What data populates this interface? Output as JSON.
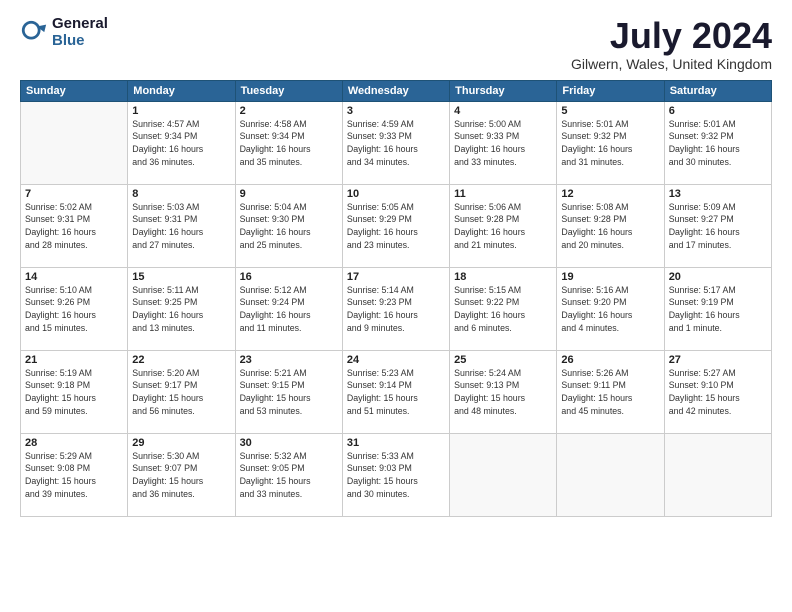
{
  "header": {
    "logo_general": "General",
    "logo_blue": "Blue",
    "month_title": "July 2024",
    "location": "Gilwern, Wales, United Kingdom"
  },
  "weekdays": [
    "Sunday",
    "Monday",
    "Tuesday",
    "Wednesday",
    "Thursday",
    "Friday",
    "Saturday"
  ],
  "days": [
    {
      "num": "",
      "info": ""
    },
    {
      "num": "1",
      "info": "Sunrise: 4:57 AM\nSunset: 9:34 PM\nDaylight: 16 hours\nand 36 minutes."
    },
    {
      "num": "2",
      "info": "Sunrise: 4:58 AM\nSunset: 9:34 PM\nDaylight: 16 hours\nand 35 minutes."
    },
    {
      "num": "3",
      "info": "Sunrise: 4:59 AM\nSunset: 9:33 PM\nDaylight: 16 hours\nand 34 minutes."
    },
    {
      "num": "4",
      "info": "Sunrise: 5:00 AM\nSunset: 9:33 PM\nDaylight: 16 hours\nand 33 minutes."
    },
    {
      "num": "5",
      "info": "Sunrise: 5:01 AM\nSunset: 9:32 PM\nDaylight: 16 hours\nand 31 minutes."
    },
    {
      "num": "6",
      "info": "Sunrise: 5:01 AM\nSunset: 9:32 PM\nDaylight: 16 hours\nand 30 minutes."
    },
    {
      "num": "7",
      "info": "Sunrise: 5:02 AM\nSunset: 9:31 PM\nDaylight: 16 hours\nand 28 minutes."
    },
    {
      "num": "8",
      "info": "Sunrise: 5:03 AM\nSunset: 9:31 PM\nDaylight: 16 hours\nand 27 minutes."
    },
    {
      "num": "9",
      "info": "Sunrise: 5:04 AM\nSunset: 9:30 PM\nDaylight: 16 hours\nand 25 minutes."
    },
    {
      "num": "10",
      "info": "Sunrise: 5:05 AM\nSunset: 9:29 PM\nDaylight: 16 hours\nand 23 minutes."
    },
    {
      "num": "11",
      "info": "Sunrise: 5:06 AM\nSunset: 9:28 PM\nDaylight: 16 hours\nand 21 minutes."
    },
    {
      "num": "12",
      "info": "Sunrise: 5:08 AM\nSunset: 9:28 PM\nDaylight: 16 hours\nand 20 minutes."
    },
    {
      "num": "13",
      "info": "Sunrise: 5:09 AM\nSunset: 9:27 PM\nDaylight: 16 hours\nand 17 minutes."
    },
    {
      "num": "14",
      "info": "Sunrise: 5:10 AM\nSunset: 9:26 PM\nDaylight: 16 hours\nand 15 minutes."
    },
    {
      "num": "15",
      "info": "Sunrise: 5:11 AM\nSunset: 9:25 PM\nDaylight: 16 hours\nand 13 minutes."
    },
    {
      "num": "16",
      "info": "Sunrise: 5:12 AM\nSunset: 9:24 PM\nDaylight: 16 hours\nand 11 minutes."
    },
    {
      "num": "17",
      "info": "Sunrise: 5:14 AM\nSunset: 9:23 PM\nDaylight: 16 hours\nand 9 minutes."
    },
    {
      "num": "18",
      "info": "Sunrise: 5:15 AM\nSunset: 9:22 PM\nDaylight: 16 hours\nand 6 minutes."
    },
    {
      "num": "19",
      "info": "Sunrise: 5:16 AM\nSunset: 9:20 PM\nDaylight: 16 hours\nand 4 minutes."
    },
    {
      "num": "20",
      "info": "Sunrise: 5:17 AM\nSunset: 9:19 PM\nDaylight: 16 hours\nand 1 minute."
    },
    {
      "num": "21",
      "info": "Sunrise: 5:19 AM\nSunset: 9:18 PM\nDaylight: 15 hours\nand 59 minutes."
    },
    {
      "num": "22",
      "info": "Sunrise: 5:20 AM\nSunset: 9:17 PM\nDaylight: 15 hours\nand 56 minutes."
    },
    {
      "num": "23",
      "info": "Sunrise: 5:21 AM\nSunset: 9:15 PM\nDaylight: 15 hours\nand 53 minutes."
    },
    {
      "num": "24",
      "info": "Sunrise: 5:23 AM\nSunset: 9:14 PM\nDaylight: 15 hours\nand 51 minutes."
    },
    {
      "num": "25",
      "info": "Sunrise: 5:24 AM\nSunset: 9:13 PM\nDaylight: 15 hours\nand 48 minutes."
    },
    {
      "num": "26",
      "info": "Sunrise: 5:26 AM\nSunset: 9:11 PM\nDaylight: 15 hours\nand 45 minutes."
    },
    {
      "num": "27",
      "info": "Sunrise: 5:27 AM\nSunset: 9:10 PM\nDaylight: 15 hours\nand 42 minutes."
    },
    {
      "num": "28",
      "info": "Sunrise: 5:29 AM\nSunset: 9:08 PM\nDaylight: 15 hours\nand 39 minutes."
    },
    {
      "num": "29",
      "info": "Sunrise: 5:30 AM\nSunset: 9:07 PM\nDaylight: 15 hours\nand 36 minutes."
    },
    {
      "num": "30",
      "info": "Sunrise: 5:32 AM\nSunset: 9:05 PM\nDaylight: 15 hours\nand 33 minutes."
    },
    {
      "num": "31",
      "info": "Sunrise: 5:33 AM\nSunset: 9:03 PM\nDaylight: 15 hours\nand 30 minutes."
    },
    {
      "num": "",
      "info": ""
    },
    {
      "num": "",
      "info": ""
    },
    {
      "num": "",
      "info": ""
    }
  ]
}
